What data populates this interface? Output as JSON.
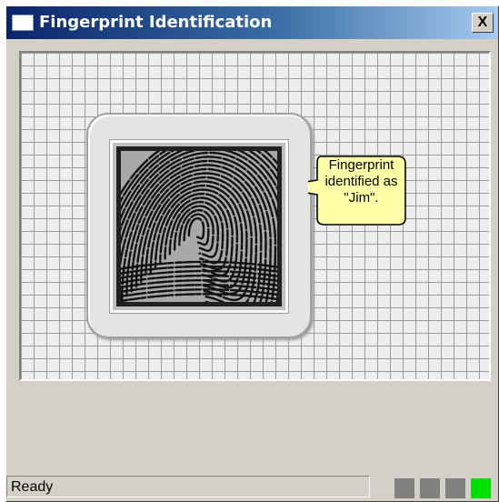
{
  "window": {
    "title": "Fingerprint Identification",
    "close_label": "X"
  },
  "scanner": {
    "fingerprint_icon": "fingerprint-image",
    "callout": {
      "lines": [
        "Fingerprint",
        "identified as",
        "\"Jim\"."
      ]
    }
  },
  "statusbar": {
    "text": "Ready",
    "indicators": [
      {
        "name": "indicator-1",
        "color": "#808080",
        "active": false
      },
      {
        "name": "indicator-2",
        "color": "#808080",
        "active": false
      },
      {
        "name": "indicator-3",
        "color": "#808080",
        "active": false
      },
      {
        "name": "indicator-4",
        "color": "#00e000",
        "active": true
      }
    ]
  },
  "colors": {
    "title_gradient_start": "#0a246a",
    "title_gradient_end": "#a6caf0",
    "callout_fill": "#ffffa8",
    "indicator_active": "#00e000"
  }
}
